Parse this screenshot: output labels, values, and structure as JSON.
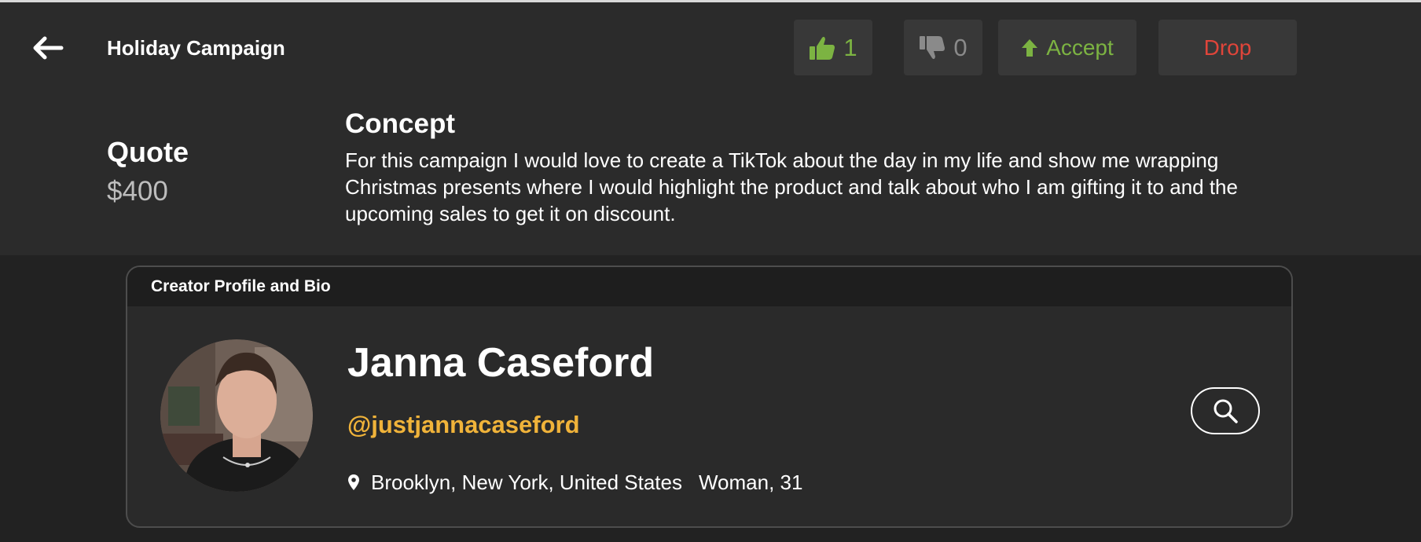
{
  "header": {
    "title": "Holiday Campaign",
    "back_icon": "arrow-left-icon"
  },
  "actions": {
    "like_count": "1",
    "dislike_count": "0",
    "accept_label": "Accept",
    "drop_label": "Drop",
    "colors": {
      "accept": "#7cb342",
      "drop": "#e0453a",
      "disabled": "#8a8a8a"
    }
  },
  "quote": {
    "label": "Quote",
    "value": "$400"
  },
  "concept": {
    "label": "Concept",
    "text": "For this campaign I would love to create a TikTok about the day in my life and show me wrapping Christmas presents where I would highlight the product and talk about who I am gifting it to and the upcoming sales to get it on discount."
  },
  "profile": {
    "section_title": "Creator Profile and Bio",
    "name": "Janna Caseford",
    "handle": "@justjannacaseford",
    "location": "Brooklyn, New York, United States",
    "demographics": "Woman, 31",
    "handle_color": "#f0b33a"
  }
}
